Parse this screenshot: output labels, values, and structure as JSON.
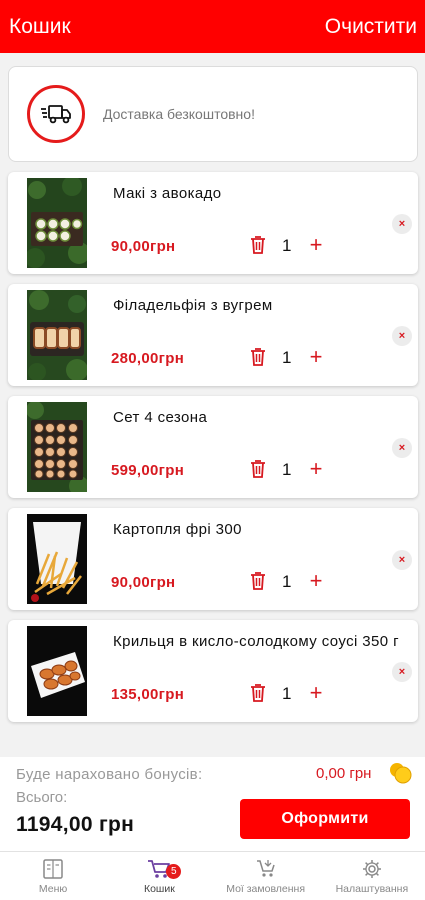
{
  "header": {
    "title": "Кошик",
    "clear_label": "Очистити"
  },
  "delivery": {
    "text": "Доставка безкоштовно!"
  },
  "cart": {
    "items": [
      {
        "name": "Макі з авокадо",
        "price": "90,00грн",
        "qty": "1",
        "image": "maki-avocado"
      },
      {
        "name": "Філадельфія з вугрем",
        "price": "280,00грн",
        "qty": "1",
        "image": "philadelphia-eel"
      },
      {
        "name": "Сет 4 сезона",
        "price": "599,00грн",
        "qty": "1",
        "image": "set-4-seasons"
      },
      {
        "name": "Картопля фрі 300",
        "price": "90,00грн",
        "qty": "1",
        "image": "french-fries"
      },
      {
        "name": "Крильця в кисло-солодкому соусі 350 г",
        "price": "135,00грн",
        "qty": "1",
        "image": "wings-sweet-sour"
      }
    ],
    "remove_glyph": "×",
    "plus_glyph": "+"
  },
  "summary": {
    "bonus_label": "Буде нараховано бонусів:",
    "bonus_value": "0,00 грн",
    "total_label": "Всього:",
    "total_value": "1194,00 грн",
    "checkout_label": "Оформити"
  },
  "tabbar": {
    "tabs": [
      {
        "label": "Меню",
        "icon": "menu-book-icon"
      },
      {
        "label": "Кошик",
        "icon": "cart-icon",
        "badge": "5",
        "active": true
      },
      {
        "label": "Мої замовлення",
        "icon": "orders-icon"
      },
      {
        "label": "Налаштування",
        "icon": "gear-icon"
      }
    ]
  },
  "colors": {
    "brand": "#ff0000",
    "price": "#d71920",
    "muted": "#999999"
  }
}
